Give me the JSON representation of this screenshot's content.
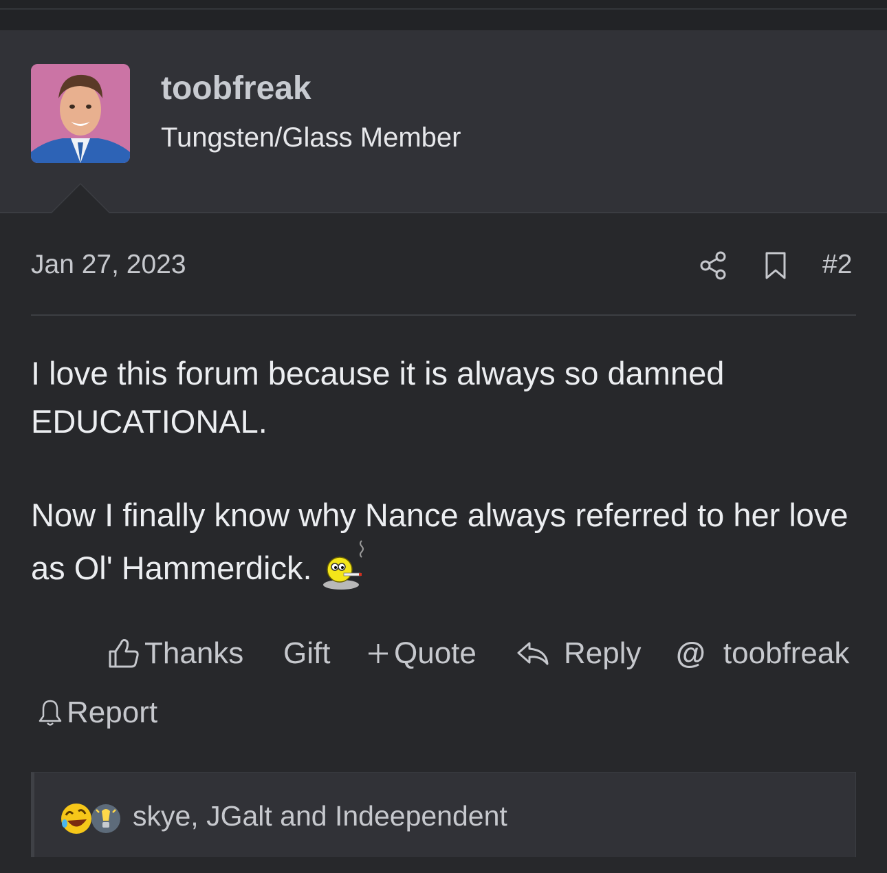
{
  "user": {
    "name": "toobfreak",
    "title": "Tungsten/Glass Member"
  },
  "post": {
    "date": "Jan 27, 2023",
    "number": "#2",
    "paragraphs": [
      "I love this forum because it is always so damned EDUCATIONAL.",
      "Now I finally know why Nance always referred to her love as Ol' Hammerdick."
    ]
  },
  "actions": {
    "thanks": "Thanks",
    "gift": "Gift",
    "quote": "Quote",
    "reply": "Reply",
    "mention": "toobfreak",
    "report": "Report"
  },
  "reactions": {
    "icons": [
      "laughing-crying-emoji",
      "lightbulb-emoji"
    ],
    "users": "skye, JGalt and Indeependent"
  },
  "colors": {
    "background": "#27282b",
    "header": "#313237",
    "text": "#eceef1",
    "muted": "#c6c8cd",
    "username": "#c8cbd1"
  }
}
